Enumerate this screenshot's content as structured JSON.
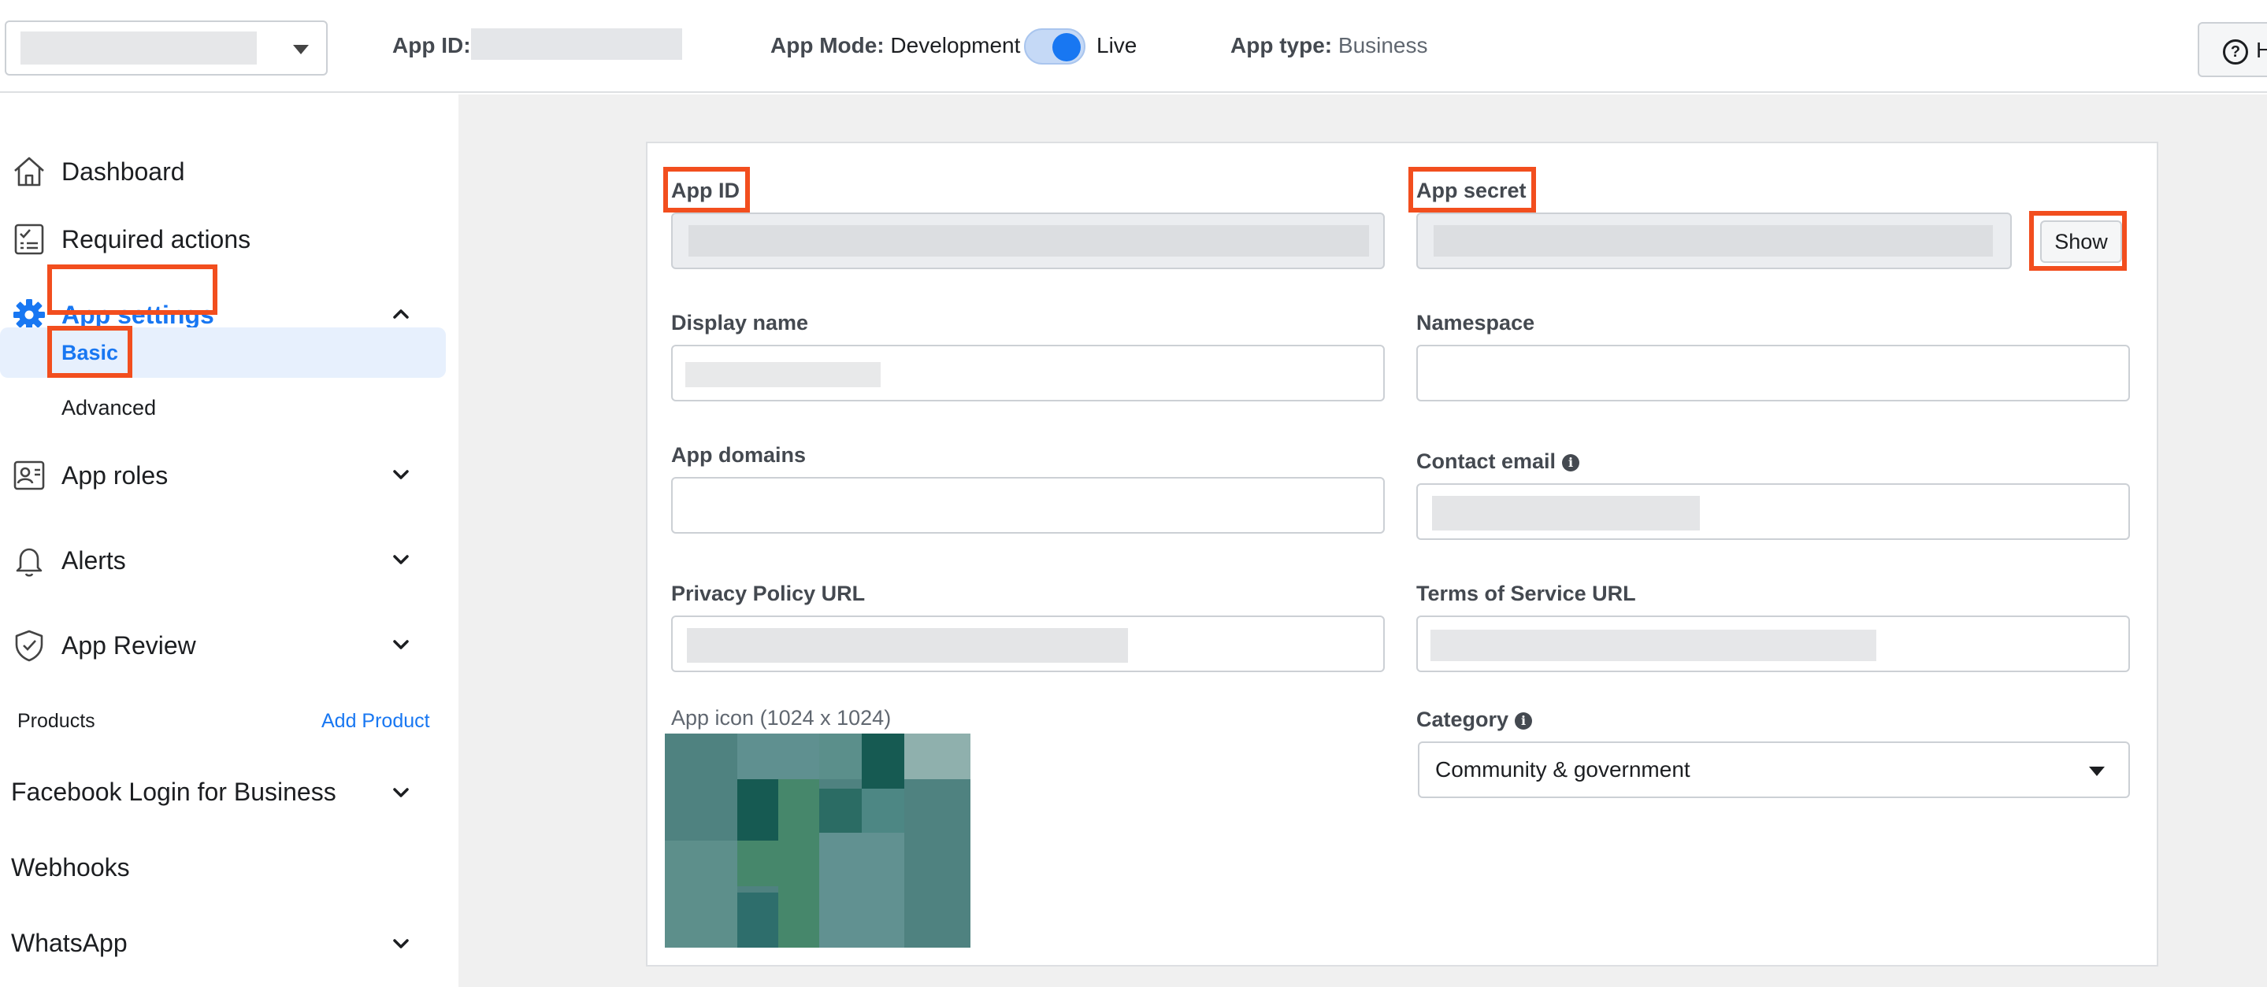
{
  "topbar": {
    "app_id_label": "App ID:",
    "app_mode_label": "App Mode:",
    "app_mode_dev": "Development",
    "app_mode_live": "Live",
    "app_type_label": "App type:",
    "app_type_value": "Business",
    "help_label": "H",
    "toggle_state": "live"
  },
  "sidebar": {
    "items": [
      {
        "label": "Dashboard",
        "icon": "home-icon"
      },
      {
        "label": "Required actions",
        "icon": "checklist-icon"
      },
      {
        "label": "App settings",
        "icon": "gear-icon",
        "expanded": true
      },
      {
        "label": "App roles",
        "icon": "id-badge-icon"
      },
      {
        "label": "Alerts",
        "icon": "bell-icon"
      },
      {
        "label": "App Review",
        "icon": "shield-check-icon"
      }
    ],
    "sub_items": [
      {
        "label": "Basic",
        "active": true
      },
      {
        "label": "Advanced",
        "active": false
      }
    ],
    "products_header": "Products",
    "add_product": "Add Product",
    "products": [
      {
        "label": "Facebook Login for Business",
        "expandable": true
      },
      {
        "label": "Webhooks",
        "expandable": false
      },
      {
        "label": "WhatsApp",
        "expandable": true
      }
    ]
  },
  "form": {
    "app_id_label": "App ID",
    "app_secret_label": "App secret",
    "show_button": "Show",
    "display_name_label": "Display name",
    "namespace_label": "Namespace",
    "app_domains_label": "App domains",
    "contact_email_label": "Contact email",
    "privacy_policy_label": "Privacy Policy URL",
    "tos_label": "Terms of Service URL",
    "app_icon_label": "App icon (1024 x 1024)",
    "category_label": "Category",
    "category_value": "Community & government"
  },
  "colors": {
    "accent": "#1877f2",
    "highlight": "#f24e1e",
    "main_bg": "#f0f0f0"
  }
}
